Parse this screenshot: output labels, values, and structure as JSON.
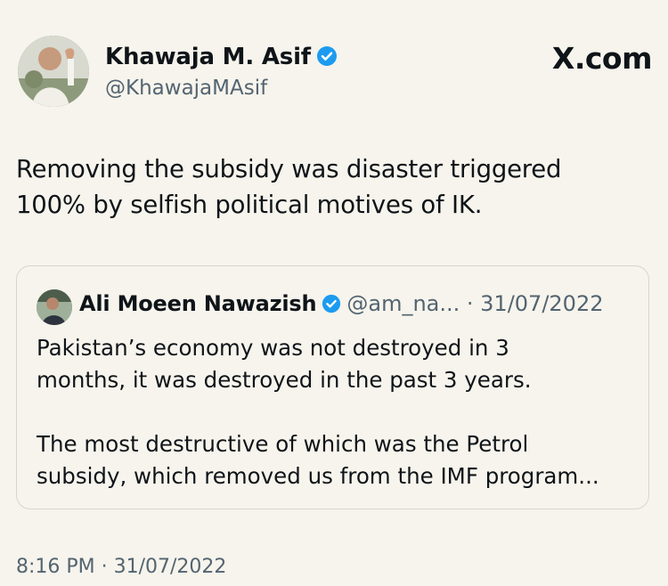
{
  "brand": {
    "label": "X.com"
  },
  "author": {
    "name": "Khawaja M. Asif",
    "handle": "@KhawajaMAsif",
    "verified": true
  },
  "tweet": {
    "text_line1": "Removing the subsidy was disaster triggered",
    "text_line2": "100% by selfish political motives of IK.",
    "timestamp": "8:16 PM · 31/07/2022"
  },
  "quoted_tweet": {
    "author_name": "Ali Moeen Nawazish",
    "handle_and_date": "@am_na... · 31/07/2022",
    "verified": true,
    "paragraph1_line1": "Pakistan’s economy was not destroyed in 3",
    "paragraph1_line2": "months, it was destroyed in the past 3 years.",
    "paragraph2_line1": "The most destructive of which was the Petrol",
    "paragraph2_line2": "subsidy, which removed us from the IMF program..."
  },
  "colors": {
    "background": "#f6f4ec",
    "text": "#0f1419",
    "muted": "#536471",
    "verified_blue": "#1d9bf0"
  },
  "icons": {
    "verified": "verified-badge-icon"
  }
}
